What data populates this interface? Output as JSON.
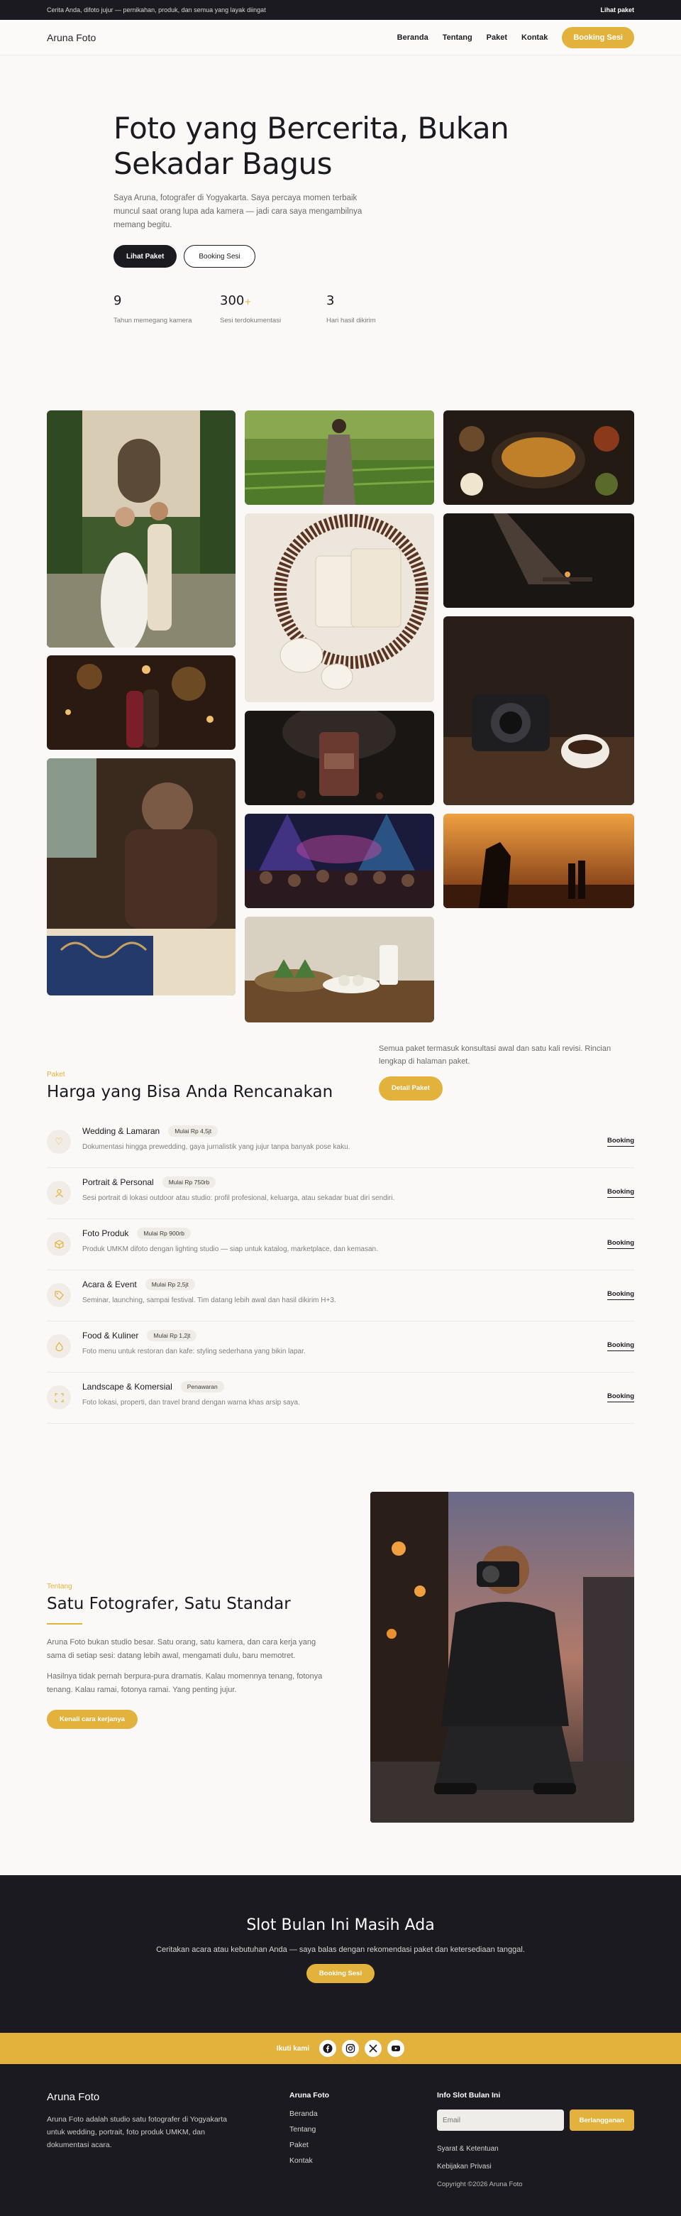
{
  "topbar": {
    "text": "Cerita Anda, difoto jujur — pernikahan, produk, dan semua yang layak diingat",
    "link": "Lihat paket"
  },
  "header": {
    "logo": "Aruna Foto",
    "nav": [
      "Beranda",
      "Tentang",
      "Paket",
      "Kontak"
    ],
    "cta": "Booking Sesi"
  },
  "hero": {
    "title_line1": "Foto yang Bercerita, Bukan",
    "title_line2": "Sekadar Bagus",
    "lead": "Saya Aruna, fotografer di Yogyakarta. Saya percaya momen terbaik muncul saat orang lupa ada kamera — jadi cara saya mengambilnya memang begitu.",
    "primary_btn": "Lihat Paket",
    "secondary_btn": "Booking Sesi",
    "stats": [
      {
        "num": "9",
        "suffix": "",
        "label": "Tahun memegang kamera"
      },
      {
        "num": "300",
        "suffix": "+",
        "label": "Sesi terdokumentasi"
      },
      {
        "num": "3",
        "suffix": "",
        "label": "Hari hasil dikirim"
      }
    ]
  },
  "pricing": {
    "eyebrow": "Paket",
    "title": "Harga yang Bisa Anda Rencanakan",
    "note": "Semua paket termasuk konsultasi awal dan satu kali revisi. Rincian lengkap di halaman paket.",
    "note_btn": "Detail Paket",
    "link_label": "Booking",
    "plans": [
      {
        "icon": "heart-icon",
        "name": "Wedding & Lamaran",
        "badge": "Mulai Rp 4,5jt",
        "desc": "Dokumentasi hingga prewedding, gaya jurnalistik yang jujur tanpa banyak pose kaku."
      },
      {
        "icon": "user-icon",
        "name": "Portrait & Personal",
        "badge": "Mulai Rp 750rb",
        "desc": "Sesi portrait di lokasi outdoor atau studio: profil profesional, keluarga, atau sekadar buat diri sendiri."
      },
      {
        "icon": "box-icon",
        "name": "Foto Produk",
        "badge": "Mulai Rp 900rb",
        "desc": "Produk UMKM difoto dengan lighting studio — siap untuk katalog, marketplace, dan kemasan."
      },
      {
        "icon": "tag-icon",
        "name": "Acara & Event",
        "badge": "Mulai Rp 2,5jt",
        "desc": "Seminar, launching, sampai festival. Tim datang lebih awal dan hasil dikirim H+3."
      },
      {
        "icon": "flame-icon",
        "name": "Food & Kuliner",
        "badge": "Mulai Rp 1,2jt",
        "desc": "Foto menu untuk restoran dan kafe: styling sederhana yang bikin lapar."
      },
      {
        "icon": "expand-icon",
        "name": "Landscape & Komersial",
        "badge": "Penawaran",
        "desc": "Foto lokasi, properti, dan travel brand dengan warna khas arsip saya."
      }
    ]
  },
  "about": {
    "eyebrow": "Tentang",
    "title": "Satu Fotografer, Satu Standar",
    "p1": "Aruna Foto bukan studio besar. Satu orang, satu kamera, dan cara kerja yang sama di setiap sesi: datang lebih awal, mengamati dulu, baru memotret.",
    "p2": "Hasilnya tidak pernah berpura-pura dramatis. Kalau momennya tenang, fotonya tenang. Kalau ramai, fotonya ramai. Yang penting jujur.",
    "btn": "Kenali cara kerjanya"
  },
  "cta": {
    "title": "Slot Bulan Ini Masih Ada",
    "text": "Ceritakan acara atau kebutuhan Anda — saya balas dengan rekomendasi paket dan ketersediaan tanggal.",
    "btn": "Booking Sesi"
  },
  "follow": {
    "label": "Ikuti kami",
    "icons": [
      "facebook-icon",
      "instagram-icon",
      "x-icon",
      "youtube-icon"
    ]
  },
  "footer": {
    "brand": "Aruna Foto",
    "desc": "Aruna Foto adalah studio satu fotografer di Yogyakarta untuk wedding, portrait, foto produk UMKM, dan dokumentasi acara.",
    "nav_head": "Aruna Foto",
    "nav": [
      "Beranda",
      "Tentang",
      "Paket",
      "Kontak"
    ],
    "info_head": "Info Slot Bulan Ini",
    "email_placeholder": "Email",
    "subscribe": "Berlangganan",
    "terms": "Syarat & Ketentuan",
    "privacy": "Kebijakan Privasi",
    "copyright": "Copyright ©2026 Aruna Foto"
  },
  "colors": {
    "accent": "#e3b23c",
    "dark": "#1b1a21",
    "background": "#faf9f7"
  }
}
